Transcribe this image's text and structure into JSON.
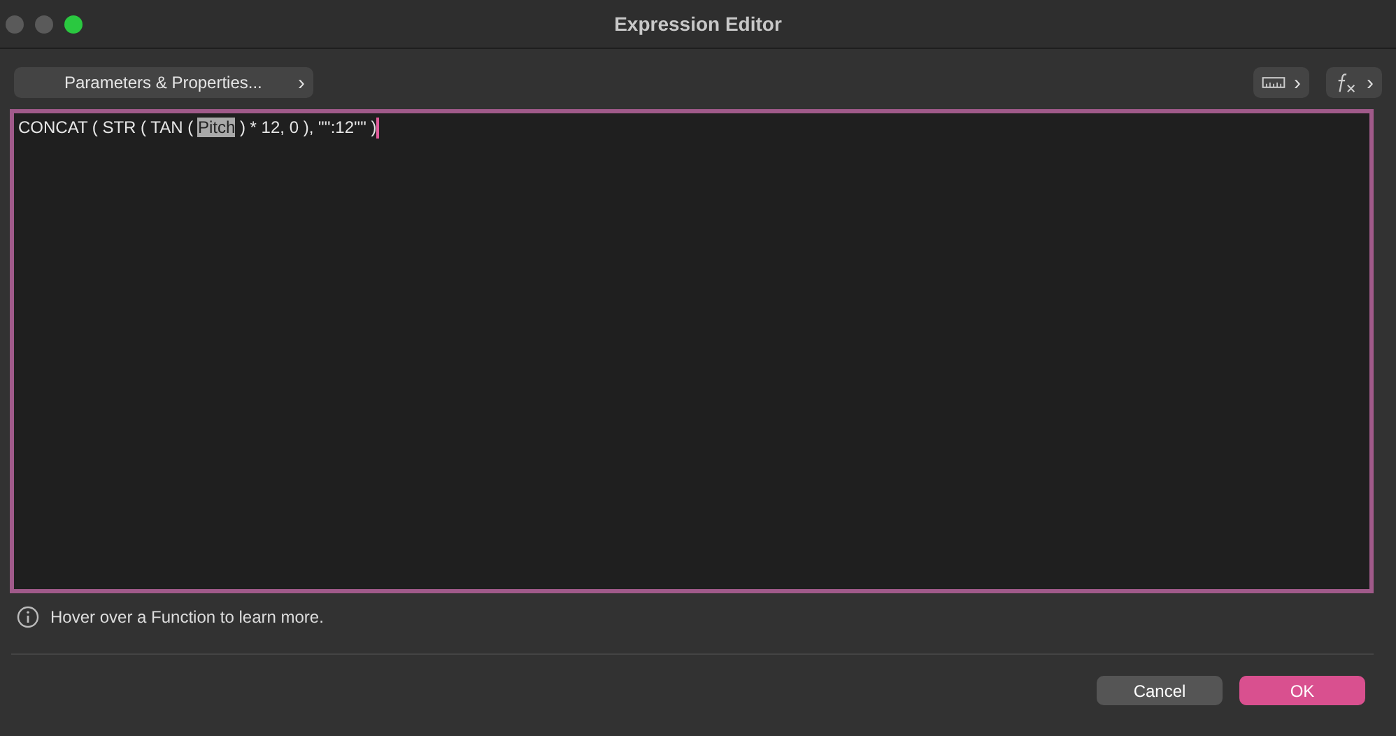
{
  "window": {
    "title": "Expression Editor"
  },
  "toolbar": {
    "parameters_button": "Parameters & Properties...",
    "chevron": "›"
  },
  "editor": {
    "text_before": "CONCAT ( STR ( TAN ( ",
    "selected_text": "Pitch",
    "text_after": " ) * 12, 0 ), \"'':12''\" )"
  },
  "hint": "Hover over a Function to learn more.",
  "buttons": [
    {
      "label": "Cancel",
      "kind": "secondary"
    },
    {
      "label": "OK",
      "kind": "primary"
    }
  ]
}
